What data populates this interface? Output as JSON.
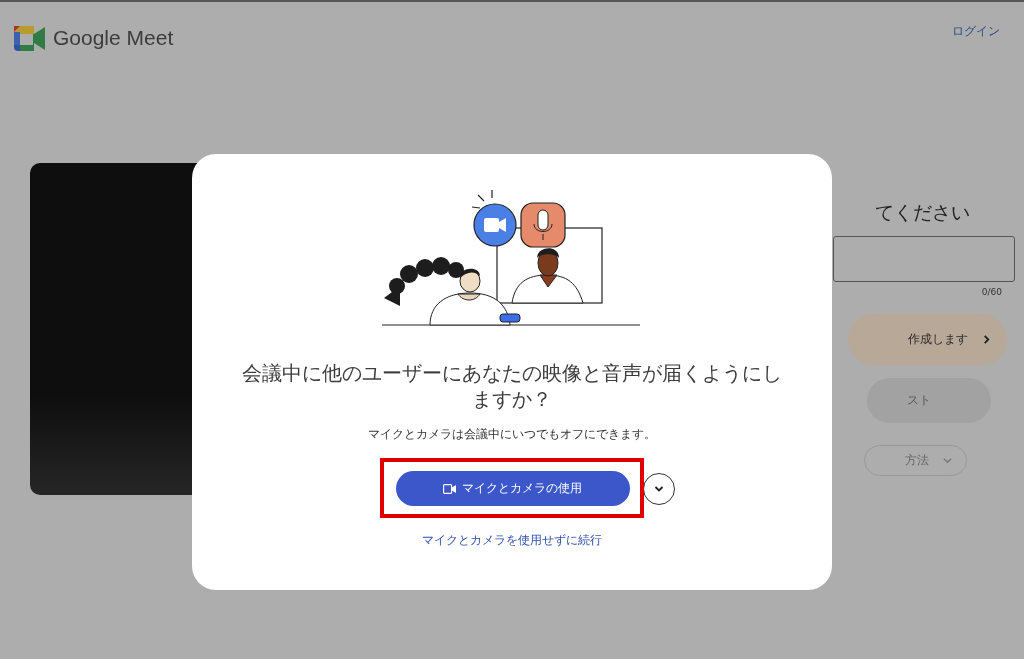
{
  "header": {
    "logo_text": "Google Meet",
    "login_link": "ログイン"
  },
  "background": {
    "heading": "てください",
    "name_counter": "0/60",
    "buttons": [
      {
        "label": "作成します",
        "kind": "primary"
      },
      {
        "label": "スト",
        "kind": "disabled"
      },
      {
        "label": "方法",
        "kind": "outline"
      }
    ]
  },
  "dialog": {
    "title": "会議中に他のユーザーにあなたの映像と音声が届くようにしますか？",
    "subtitle": "マイクとカメラは会議中にいつでもオフにできます。",
    "primary_button": {
      "label": "マイクとカメラの使用",
      "highlighted": true
    },
    "secondary_link": "マイクとカメラを使用せずに続行"
  }
}
